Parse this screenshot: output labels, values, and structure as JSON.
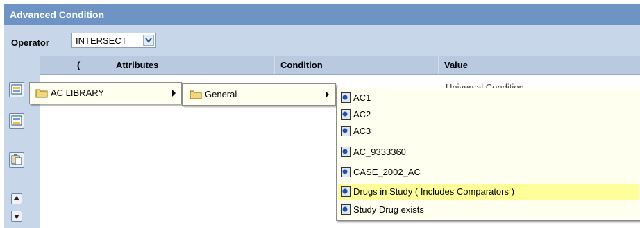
{
  "panel": {
    "title": "Advanced Condition"
  },
  "operator": {
    "label": "Operator",
    "value": "INTERSECT"
  },
  "grid": {
    "columns": [
      "(",
      "Attributes",
      "Condition",
      "Value"
    ],
    "first_row_value_partial": "Universal Condition"
  },
  "menus": {
    "level1": {
      "label": "AC LIBRARY"
    },
    "level2": {
      "label": "General"
    },
    "level3": {
      "items": [
        "AC1",
        "AC2",
        "AC3",
        "AC_9333360",
        "CASE_2002_AC",
        "Drugs in Study ( Includes Comparators )",
        "Study Drug exists"
      ],
      "highlighted": "Drugs in Study ( Includes Comparators )"
    }
  },
  "icons": {
    "add_row": "add-row-icon",
    "insert_row": "insert-row-icon",
    "paste": "paste-icon",
    "move_up": "arrow-up-icon",
    "move_down": "arrow-down-icon",
    "folder": "folder-icon",
    "condition": "condition-icon"
  },
  "colors": {
    "titlebar": "#6d94c5",
    "panel": "#c8d6ea",
    "menu_bg": "#fffff0",
    "highlight": "#ffff99"
  }
}
